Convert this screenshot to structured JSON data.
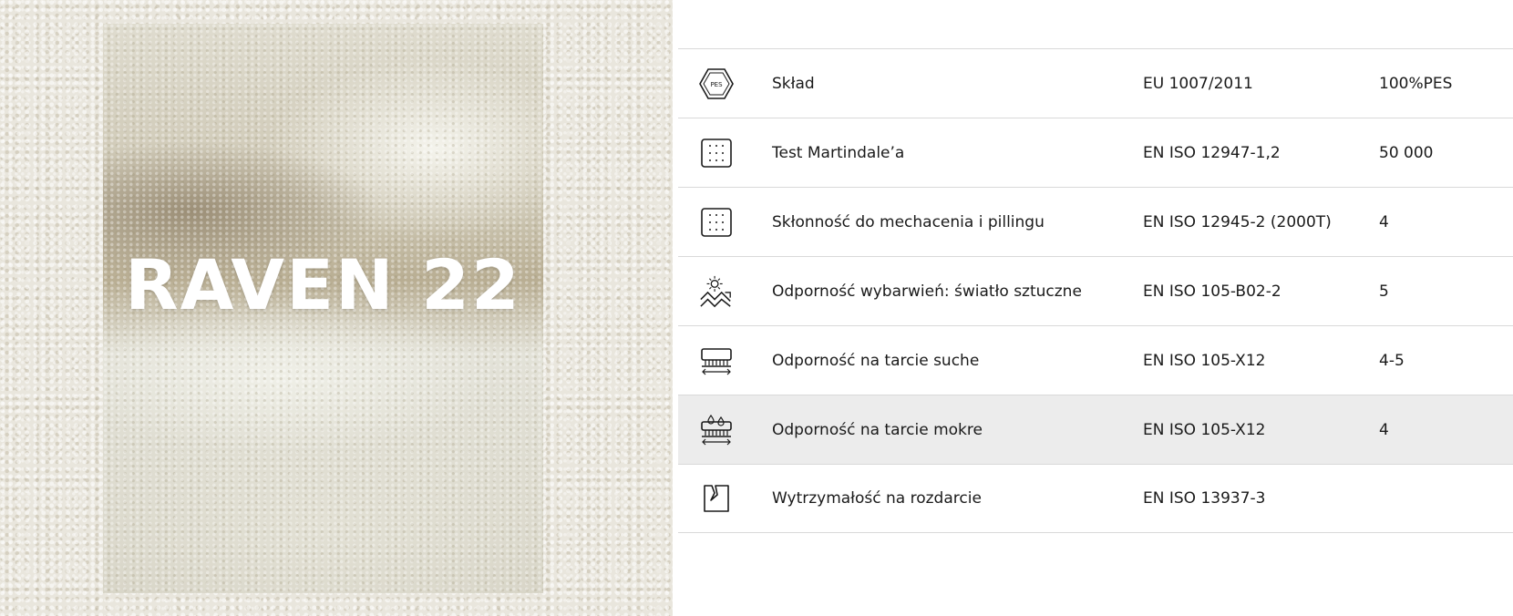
{
  "hero": {
    "title": "RAVEN 22"
  },
  "specs": [
    {
      "icon": "hexagon-composition-icon",
      "name": "Skład",
      "norm": "EU 1007/2011",
      "value": "100%PES",
      "icon_text": "PES"
    },
    {
      "icon": "dotted-grid-icon",
      "name": "Test Martindale’a",
      "norm": "EN ISO 12947-1,2",
      "value": "50 000"
    },
    {
      "icon": "dotted-grid-icon",
      "name": "Skłonność do mechacenia i pillingu",
      "norm": "EN ISO 12945-2 (2000T)",
      "value": "4"
    },
    {
      "icon": "sun-fabric-icon",
      "name": "Odporność wybarwień: światło sztuczne",
      "norm": "EN ISO 105-B02-2",
      "value": "5"
    },
    {
      "icon": "brush-dry-icon",
      "name": "Odporność na tarcie suche",
      "norm": "EN ISO 105-X12",
      "value": "4-5"
    },
    {
      "icon": "brush-wet-icon",
      "name": "Odporność na tarcie mokre",
      "norm": "EN ISO 105-X12",
      "value": "4"
    },
    {
      "icon": "tear-strength-icon",
      "name": "Wytrzymałość na rozdarcie",
      "norm": "EN ISO 13937-3",
      "value": ""
    }
  ],
  "colors": {
    "row_border": "#d9d9d9",
    "highlight_row": "#ececec",
    "text": "#1a1a1a"
  }
}
